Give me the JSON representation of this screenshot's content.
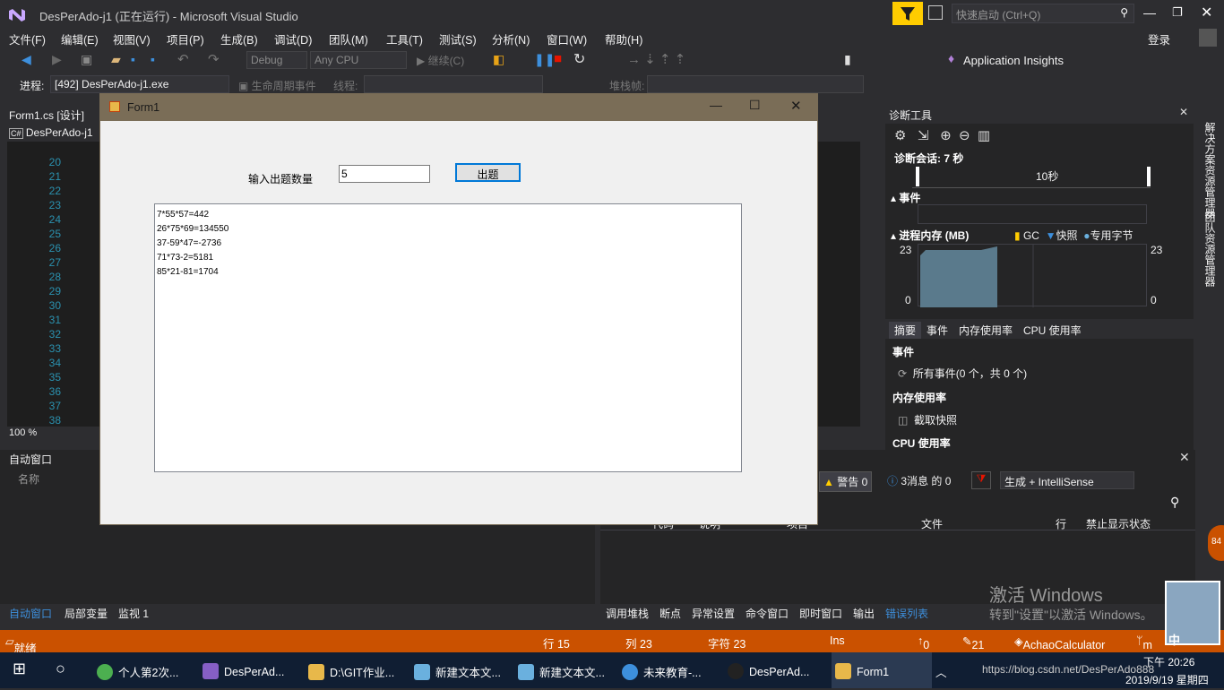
{
  "window": {
    "title": "DesPerAdo-j1 (正在运行) - Microsoft Visual Studio",
    "quick_launch": "快速启动 (Ctrl+Q)",
    "login": "登录"
  },
  "menu": [
    "文件(F)",
    "编辑(E)",
    "视图(V)",
    "项目(P)",
    "生成(B)",
    "调试(D)",
    "团队(M)",
    "工具(T)",
    "测试(S)",
    "分析(N)",
    "窗口(W)",
    "帮助(H)"
  ],
  "toolbar": {
    "config": "Debug",
    "platform": "Any CPU",
    "continue": "继续(C)",
    "insights": "Application Insights"
  },
  "debugbar": {
    "process_label": "进程:",
    "process": "[492] DesPerAdo-j1.exe",
    "lifecycle": "生命周期事件",
    "thread_label": "线程:",
    "stack_label": "堆栈帧:"
  },
  "doc_tabs": {
    "form_tab": "Form1.cs [设计]",
    "project": "DesPerAdo-j1"
  },
  "editor": {
    "line_numbers": [
      "20",
      "21",
      "22",
      "23",
      "24",
      "25",
      "26",
      "27",
      "28",
      "29",
      "30",
      "31",
      "32",
      "33",
      "34",
      "35",
      "36",
      "37",
      "38"
    ],
    "zoom": "100 %"
  },
  "diag": {
    "title": "诊断工具",
    "session": "诊断会话: 7 秒",
    "time_tick": "10秒",
    "events": "事件",
    "memory": "进程内存 (MB)",
    "gc": "GC",
    "snapshot": "快照",
    "private_bytes": "专用字节",
    "y_max": "23",
    "y_min": "0",
    "tabs": [
      "摘要",
      "事件",
      "内存使用率",
      "CPU 使用率"
    ],
    "sec_events": "事件",
    "all_events": "所有事件(0 个，共 0 个)",
    "sec_memory": "内存使用率",
    "take_snapshot": "截取快照",
    "sec_cpu": "CPU 使用率",
    "side_tabs": [
      "解决方案资源管理器",
      "团队资源管理器"
    ]
  },
  "autos": {
    "title": "自动窗口",
    "col_name": "名称"
  },
  "errors": {
    "warnings": "警告 0",
    "messages": "3消息 的 0",
    "filter": "生成 + IntelliSense",
    "col_code": "代码",
    "col_desc": "说明",
    "col_project": "项目",
    "col_file": "文件",
    "col_line": "行",
    "col_suppress": "禁止显示状态"
  },
  "bottom_tabs_left": [
    "自动窗口",
    "局部变量",
    "监视 1"
  ],
  "bottom_tabs_right": [
    "调用堆栈",
    "断点",
    "异常设置",
    "命令窗口",
    "即时窗口",
    "输出",
    "错误列表"
  ],
  "status": {
    "ready": "就绪",
    "line": "行 15",
    "col": "列 23",
    "char": "字符 23",
    "ins": "Ins",
    "up": "0",
    "edits": "21",
    "project": "AchaoCalculator",
    "branch": "m"
  },
  "watermark": {
    "line1": "激活 Windows",
    "line2": "转到\"设置\"以激活 Windows。"
  },
  "form1": {
    "title": "Form1",
    "label": "输入出题数量",
    "input_value": "5",
    "button": "出题",
    "output": [
      "7*55*57=442",
      "26*75*69=134550",
      "37-59*47=-2736",
      "71*73-2=5181",
      "85*21-81=1704"
    ]
  },
  "taskbar": {
    "items": [
      "个人第2次...",
      "DesPerAd...",
      "D:\\GIT作业...",
      "新建文本文...",
      "新建文本文...",
      "未来教育-...",
      "DesPerAd...",
      "Form1"
    ],
    "time": "下午 20:26",
    "date": "2019/9/19 星期四",
    "url": "https://blog.csdn.net/DesPerAdo888",
    "ime": "中",
    "badge": "84"
  },
  "colors": {
    "accent": "#ca5100",
    "vs_dark": "#2d2d30",
    "form_title": "#7a6d57",
    "chart_fill": "#5a7a8c"
  }
}
